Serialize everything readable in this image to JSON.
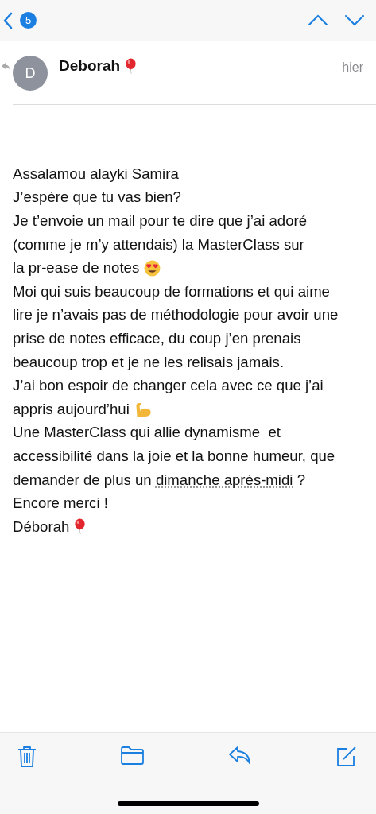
{
  "nav": {
    "unread_count": "5"
  },
  "message": {
    "avatar_initial": "D",
    "sender": {
      "name": "Deborah",
      "kind": "balloon"
    },
    "date": "hier",
    "replied": true,
    "lines": [
      {
        "text": "Assalamou alayki Samira"
      },
      {
        "text": "J’espère que tu vas bien?"
      },
      {
        "text": "Je t’envoie un mail pour te dire que j’ai adoré"
      },
      {
        "text": "(comme je m’y attendais) la MasterClass sur"
      },
      {
        "text": "la pr-ease de notes",
        "kind": "heart-eyes"
      },
      {
        "text": "Moi qui suis beaucoup de formations et qui aime"
      },
      {
        "text": "lire je n’avais pas de méthodologie pour avoir une"
      },
      {
        "text": "prise de notes efficace, du coup j’en prenais"
      },
      {
        "text": "beaucoup trop et je ne les relisais jamais."
      },
      {
        "text": "J’ai bon espoir de changer cela avec ce que j’ai"
      },
      {
        "text": "appris aujourd’hui",
        "kind": "muscle"
      },
      {
        "text": "Une MasterClass qui allie dynamisme  et"
      },
      {
        "text": "accessibilité dans la joie et la bonne humeur, que"
      },
      {
        "text": "demander de plus un ",
        "link": "dimanche après-midi",
        "after": " ?"
      },
      {
        "text": "Encore merci !"
      },
      {
        "text": "Déborah",
        "kind": "balloon"
      }
    ]
  }
}
